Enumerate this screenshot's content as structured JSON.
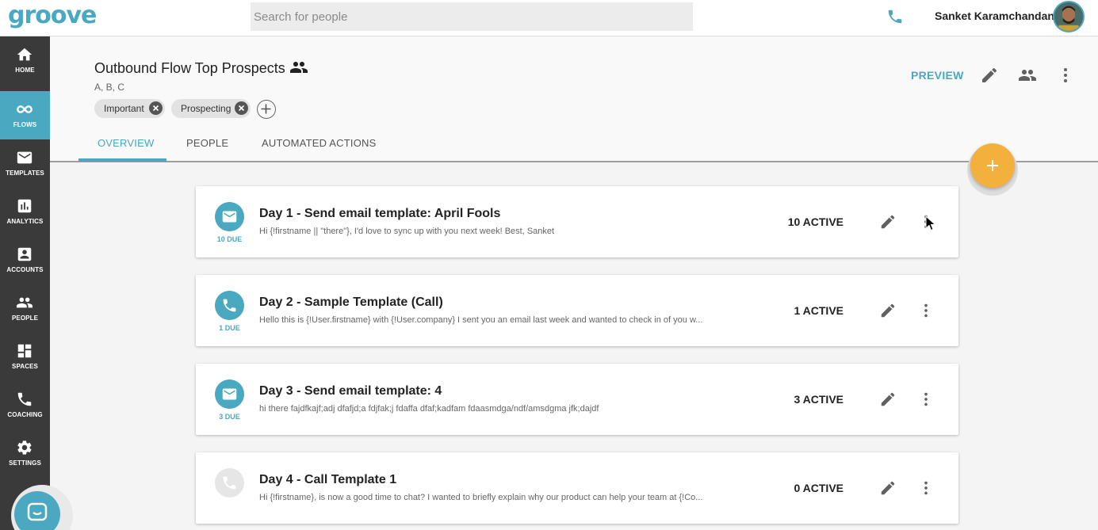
{
  "app": {
    "logo": "groove",
    "search_placeholder": "Search for people",
    "user_name": "Sanket Karamchandani"
  },
  "sidebar": {
    "items": [
      {
        "label": "HOME",
        "icon": "home-icon"
      },
      {
        "label": "FLOWS",
        "icon": "infinity-icon",
        "active": true
      },
      {
        "label": "TEMPLATES",
        "icon": "mail-icon"
      },
      {
        "label": "ANALYTICS",
        "icon": "bar-chart-icon"
      },
      {
        "label": "ACCOUNTS",
        "icon": "account-box-icon"
      },
      {
        "label": "PEOPLE",
        "icon": "people-icon"
      },
      {
        "label": "SPACES",
        "icon": "dashboard-icon"
      },
      {
        "label": "COACHING",
        "icon": "phone-icon"
      },
      {
        "label": "SETTINGS",
        "icon": "gear-icon"
      }
    ]
  },
  "flow": {
    "title": "Outbound Flow Top Prospects",
    "subtitle": "A, B, C",
    "tags": [
      "Important",
      "Prospecting"
    ],
    "preview_label": "PREVIEW",
    "tabs": [
      "OVERVIEW",
      "PEOPLE",
      "AUTOMATED ACTIONS"
    ],
    "active_tab": "OVERVIEW"
  },
  "steps": [
    {
      "type": "email",
      "due": "10 DUE",
      "title": "Day 1 - Send email template: April Fools",
      "preview": "Hi {!firstname || \"there\"}, I'd love to sync up with you next week! Best, Sanket",
      "active": "10 ACTIVE"
    },
    {
      "type": "call",
      "due": "1 DUE",
      "title": "Day 2 - Sample Template (Call)",
      "preview": "Hello this is {!User.firstname} with {!User.company} I sent you an email last week and wanted to check in of you w...",
      "active": "1 ACTIVE"
    },
    {
      "type": "email",
      "due": "3 DUE",
      "title": "Day 3 - Send email template: 4",
      "preview": "hi there fajdfkajf;adj dfafjd;a fdjfak;j fdaffa dfaf;kadfam fdaasmdga/ndf/amsdgma jfk;dajdf",
      "active": "3 ACTIVE"
    },
    {
      "type": "call",
      "due": "",
      "title": "Day 4 - Call Template 1",
      "preview": "Hi {!firstname}, is now a good time to chat? I wanted to briefly explain why our product can help your team at {!Co...",
      "active": "0 ACTIVE"
    }
  ],
  "colors": {
    "accent": "#4aa8c0",
    "fab": "#f4b03d",
    "sidebar": "#3a3a3a"
  }
}
